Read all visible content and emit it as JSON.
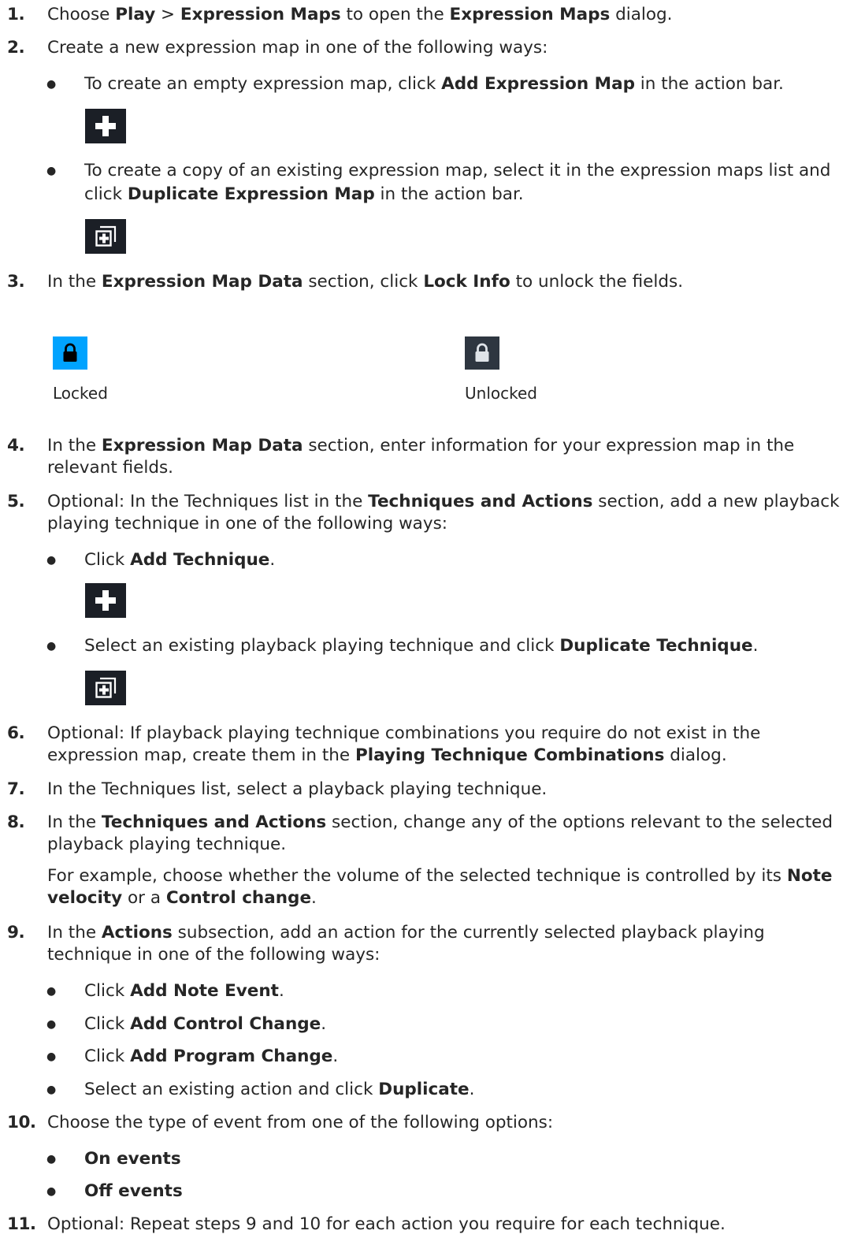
{
  "steps": [
    {
      "num": "1.",
      "parts": [
        {
          "t": "Choose "
        },
        {
          "b": "Play"
        },
        {
          "t": " > "
        },
        {
          "b": "Expression Maps"
        },
        {
          "t": " to open the "
        },
        {
          "b": "Expression Maps"
        },
        {
          "t": " dialog."
        }
      ]
    },
    {
      "num": "2.",
      "text": "Create a new expression map in one of the following ways:",
      "bullets": [
        {
          "line1": [
            {
              "t": "To create an empty expression map, click "
            },
            {
              "b": "Add Expression Map"
            },
            {
              "t": " in the action bar."
            }
          ],
          "icon": "plus-icon"
        },
        {
          "line1": [
            {
              "t": "To create a copy of an existing expression map, select it in the expression maps list and"
            }
          ],
          "line2": [
            {
              "t": "click "
            },
            {
              "b": "Duplicate Expression Map"
            },
            {
              "t": " in the action bar."
            }
          ],
          "icon": "duplicate-icon"
        }
      ]
    },
    {
      "num": "3.",
      "parts": [
        {
          "t": "In the "
        },
        {
          "b": "Expression Map Data"
        },
        {
          "t": " section, click "
        },
        {
          "b": "Lock Info"
        },
        {
          "t": " to unlock the fields."
        }
      ],
      "lock_states": [
        {
          "label": "Locked",
          "icon": "lock-locked-icon",
          "bg": "#00a3ff"
        },
        {
          "label": "Unlocked",
          "icon": "lock-unlocked-icon",
          "bg": "#2e3640"
        }
      ]
    },
    {
      "num": "4.",
      "line1": [
        {
          "t": "In the "
        },
        {
          "b": "Expression Map Data"
        },
        {
          "t": " section, enter information for your expression map in the"
        }
      ],
      "line2": [
        {
          "t": "relevant fields."
        }
      ]
    },
    {
      "num": "5.",
      "line1": [
        {
          "t": "Optional: In the Techniques list in the "
        },
        {
          "b": "Techniques and Actions"
        },
        {
          "t": " section, add a new playback"
        }
      ],
      "line2": [
        {
          "t": "playing technique in one of the following ways:"
        }
      ],
      "bullets": [
        {
          "line1": [
            {
              "t": "Click "
            },
            {
              "b": "Add Technique"
            },
            {
              "t": "."
            }
          ],
          "icon": "plus-icon"
        },
        {
          "line1": [
            {
              "t": "Select an existing playback playing technique and click "
            },
            {
              "b": "Duplicate Technique"
            },
            {
              "t": "."
            }
          ],
          "icon": "duplicate-icon"
        }
      ]
    },
    {
      "num": "6.",
      "line1": [
        {
          "t": "Optional: If playback playing technique combinations you require do not exist in the"
        }
      ],
      "line2": [
        {
          "t": "expression map, create them in the "
        },
        {
          "b": "Playing Technique Combinations"
        },
        {
          "t": " dialog."
        }
      ]
    },
    {
      "num": "7.",
      "line1": [
        {
          "t": "In the Techniques list, select a playback playing technique."
        }
      ]
    },
    {
      "num": "8.",
      "line1": [
        {
          "t": "In the "
        },
        {
          "b": "Techniques and Actions"
        },
        {
          "t": " section, change any of the options relevant to the selected"
        }
      ],
      "line2": [
        {
          "t": "playback playing technique."
        }
      ],
      "line3": [
        {
          "t": "For example, choose whether the volume of the selected technique is controlled by its "
        },
        {
          "b": "Note"
        }
      ],
      "line4": [
        {
          "b": "velocity"
        },
        {
          "t": " or a "
        },
        {
          "b": "Control change"
        },
        {
          "t": "."
        }
      ]
    },
    {
      "num": "9.",
      "line1": [
        {
          "t": "In the "
        },
        {
          "b": "Actions"
        },
        {
          "t": " subsection, add an action for the currently selected playback playing"
        }
      ],
      "line2": [
        {
          "t": "technique in one of the following ways:"
        }
      ],
      "bullets": [
        {
          "line1": [
            {
              "t": "Click "
            },
            {
              "b": "Add Note Event"
            },
            {
              "t": "."
            }
          ]
        },
        {
          "line1": [
            {
              "t": "Click "
            },
            {
              "b": "Add Control Change"
            },
            {
              "t": "."
            }
          ]
        },
        {
          "line1": [
            {
              "t": "Click "
            },
            {
              "b": "Add Program Change"
            },
            {
              "t": "."
            }
          ]
        },
        {
          "line1": [
            {
              "t": "Select an existing action and click "
            },
            {
              "b": "Duplicate"
            },
            {
              "t": "."
            }
          ]
        }
      ]
    },
    {
      "num": "10.",
      "line1": [
        {
          "t": "Choose the type of event from one of the following options:"
        }
      ],
      "bullets": [
        {
          "line1": [
            {
              "b": "On events"
            }
          ]
        },
        {
          "line1": [
            {
              "b": "Off events"
            }
          ]
        }
      ]
    },
    {
      "num": "11.",
      "line1": [
        {
          "t": "Optional: Repeat steps 9 and 10 for each action you require for each technique."
        }
      ]
    }
  ],
  "bullet_glyph": "●"
}
